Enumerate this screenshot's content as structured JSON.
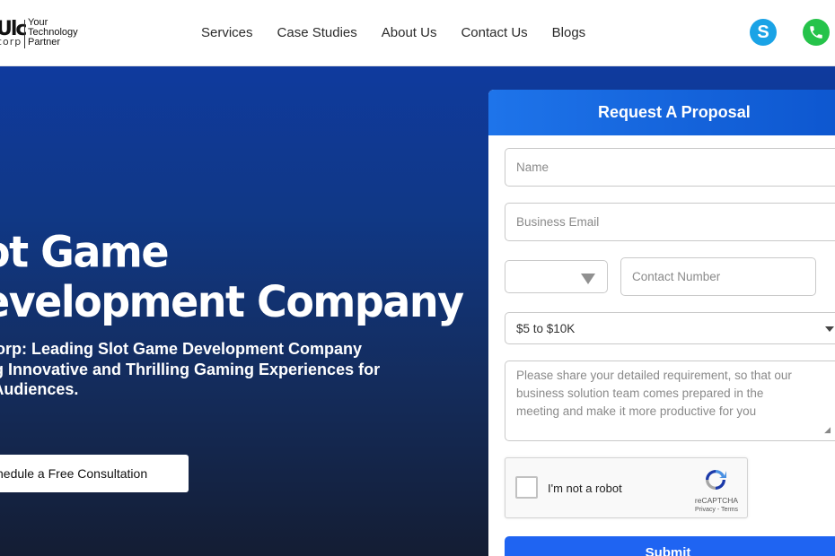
{
  "header": {
    "logo": {
      "mark": "Ulc",
      "sub": "corp",
      "tagline": [
        "Your",
        "Technology",
        "Partner"
      ]
    },
    "nav": [
      {
        "label": "Services"
      },
      {
        "label": "Case Studies"
      },
      {
        "label": "About Us"
      },
      {
        "label": "Contact Us"
      },
      {
        "label": "Blogs"
      }
    ],
    "icons": {
      "skype": "skype-icon",
      "whatsapp": "whatsapp-icon"
    }
  },
  "hero": {
    "title_lines": [
      "ot Game",
      "evelopment Company"
    ],
    "subtitle_lines": [
      "Corp: Leading Slot Game Development Company",
      "ng Innovative and Thrilling Gaming Experiences for",
      "l Audiences."
    ],
    "cta_label": "hedule a Free Consultation"
  },
  "form": {
    "title": "Request A Proposal",
    "name_placeholder": "Name",
    "email_placeholder": "Business Email",
    "country_value": "",
    "phone_placeholder": "Contact Number",
    "budget_value": "$5 to $10K",
    "requirement_placeholder": "Please share your detailed requirement, so that our business solution team comes prepared in the meeting and make it more productive for you",
    "requirement_lines": [
      "Please share your detailed requirement, so that our",
      "business solution team comes prepared in the",
      "meeting and make it more productive for you"
    ],
    "captcha": {
      "label": "I'm not a robot",
      "brand": "reCAPTCHA",
      "links": "Privacy - Terms"
    },
    "submit_label": "Submit"
  },
  "colors": {
    "accent": "#1e74ea",
    "submit": "#1f64f2",
    "hero_top": "#0f3a9e",
    "hero_bottom": "#141d33",
    "skype": "#1aa3e6",
    "whatsapp": "#25c34a"
  }
}
